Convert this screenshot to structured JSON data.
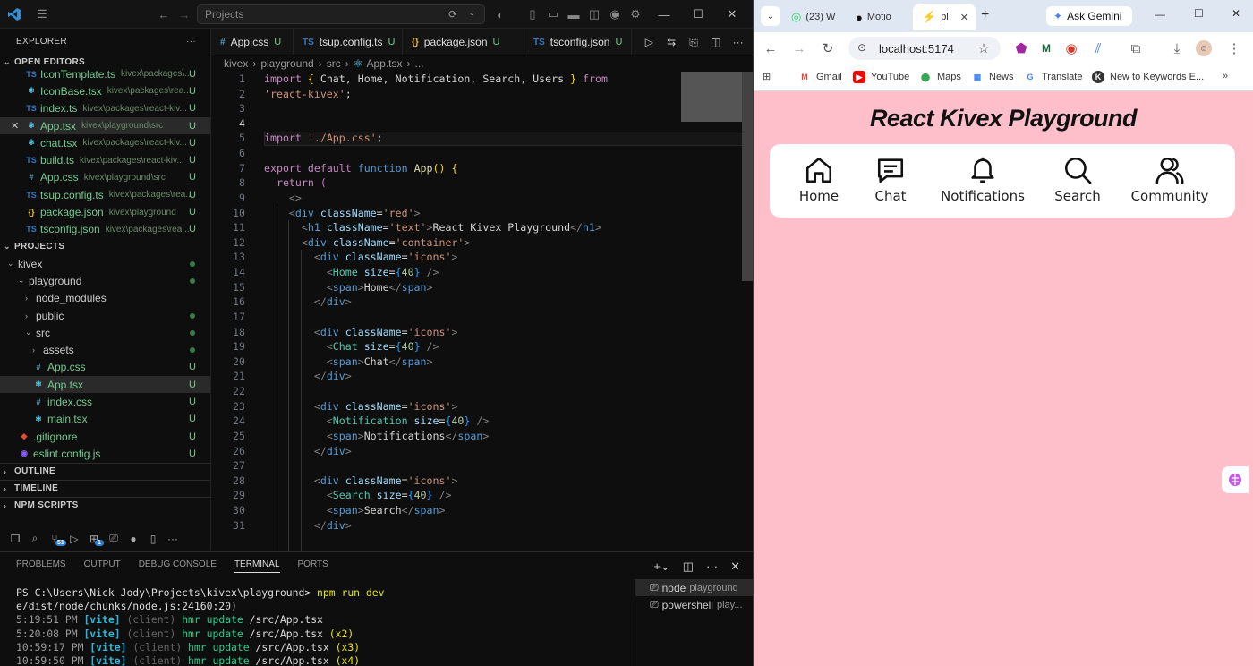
{
  "vscode": {
    "search_placeholder": "Projects",
    "explorer_title": "EXPLORER",
    "open_editors_title": "OPEN EDITORS",
    "open_editors": [
      {
        "type": "TS",
        "name": "IconTemplate.ts",
        "path": "kivex\\packages\\...",
        "status": "U"
      },
      {
        "type": "React",
        "name": "IconBase.tsx",
        "path": "kivex\\packages\\rea...",
        "status": "U"
      },
      {
        "type": "TS",
        "name": "index.ts",
        "path": "kivex\\packages\\react-kiv...",
        "status": "U"
      },
      {
        "type": "React",
        "name": "App.tsx",
        "path": "kivex\\playground\\src",
        "status": "U"
      },
      {
        "type": "React",
        "name": "chat.tsx",
        "path": "kivex\\packages\\react-kiv...",
        "status": "U"
      },
      {
        "type": "TS",
        "name": "build.ts",
        "path": "kivex\\packages\\react-kiv...",
        "status": "U"
      },
      {
        "type": "#",
        "name": "App.css",
        "path": "kivex\\playground\\src",
        "status": "U"
      },
      {
        "type": "TS",
        "name": "tsup.config.ts",
        "path": "kivex\\packages\\rea...",
        "status": "U"
      },
      {
        "type": "{}",
        "name": "package.json",
        "path": "kivex\\playground",
        "status": "U"
      },
      {
        "type": "TS",
        "name": "tsconfig.json",
        "path": "kivex\\packages\\rea...",
        "status": "U"
      }
    ],
    "projects_title": "PROJECTS",
    "tree": [
      {
        "label": "kivex",
        "status": "",
        "dot": true
      },
      {
        "label": "playground",
        "status": "",
        "dot": true
      },
      {
        "label": "node_modules",
        "status": ""
      },
      {
        "label": "public",
        "status": "",
        "dot": true
      },
      {
        "label": "src",
        "status": "",
        "dot": true
      },
      {
        "label": "assets",
        "status": "",
        "dot": true
      },
      {
        "label": "App.css",
        "status": "U"
      },
      {
        "label": "App.tsx",
        "status": "U"
      },
      {
        "label": "index.css",
        "status": "U"
      },
      {
        "label": "main.tsx",
        "status": "U"
      },
      {
        "label": ".gitignore",
        "status": "U"
      },
      {
        "label": "eslint.config.js",
        "status": "U"
      }
    ],
    "outline_title": "OUTLINE",
    "timeline_title": "TIMELINE",
    "npm_title": "NPM SCRIPTS",
    "tabs": [
      {
        "icon": "#",
        "label": "App.css",
        "status": "U"
      },
      {
        "icon": "TS",
        "label": "tsup.config.ts",
        "status": "U"
      },
      {
        "icon": "{}",
        "label": "package.json",
        "status": "U"
      },
      {
        "icon": "TS",
        "label": "tsconfig.json",
        "status": "U"
      }
    ],
    "breadcrumb": [
      "kivex",
      "playground",
      "src",
      "App.tsx",
      "..."
    ],
    "code_lines": [
      1,
      2,
      3,
      4,
      5,
      6,
      7,
      8,
      9,
      10,
      11,
      12,
      13,
      14,
      15,
      16,
      17,
      18,
      19,
      20,
      21,
      22,
      23,
      24,
      25,
      26,
      27,
      28,
      29,
      30,
      31
    ],
    "current_line": 4,
    "panel_tabs": [
      "PROBLEMS",
      "OUTPUT",
      "DEBUG CONSOLE",
      "TERMINAL",
      "PORTS"
    ],
    "terminal": {
      "prompt": "PS C:\\Users\\Nick Jody\\Projects\\kivex\\playground>",
      "command": "npm run dev",
      "line2": "e/dist/node/chunks/node.js:24160:20)",
      "updates": [
        {
          "time": "5:19:51 PM",
          "tag": "[vite]",
          "client": "(client)",
          "msg": "hmr update",
          "file": "/src/App.tsx",
          "count": ""
        },
        {
          "time": "5:20:08 PM",
          "tag": "[vite]",
          "client": "(client)",
          "msg": "hmr update",
          "file": "/src/App.tsx",
          "count": "(x2)"
        },
        {
          "time": "10:59:17 PM",
          "tag": "[vite]",
          "client": "(client)",
          "msg": "hmr update",
          "file": "/src/App.tsx",
          "count": "(x3)"
        },
        {
          "time": "10:59:50 PM",
          "tag": "[vite]",
          "client": "(client)",
          "msg": "hmr update",
          "file": "/src/App.tsx",
          "count": "(x4)"
        }
      ]
    },
    "terminals": [
      {
        "name": "node",
        "sub": "playground"
      },
      {
        "name": "powershell",
        "sub": "play..."
      }
    ],
    "badge_count": "51",
    "badge_count2": "1"
  },
  "browser": {
    "tabs": [
      {
        "label": "(23) W"
      },
      {
        "label": "Motio"
      },
      {
        "label": "pl"
      }
    ],
    "ask_gemini": "Ask Gemini",
    "url": "localhost:5174",
    "bookmarks": [
      "Gmail",
      "YouTube",
      "Maps",
      "News",
      "Translate",
      "New to Keywords E..."
    ],
    "page_title": "React Kivex Playground",
    "icons": [
      {
        "label": "Home",
        "icon": "home-icon"
      },
      {
        "label": "Chat",
        "icon": "chat-icon"
      },
      {
        "label": "Notifications",
        "icon": "notification-icon"
      },
      {
        "label": "Search",
        "icon": "search-icon"
      },
      {
        "label": "Community",
        "icon": "users-icon"
      }
    ],
    "page_bg": "#ffbfca"
  }
}
